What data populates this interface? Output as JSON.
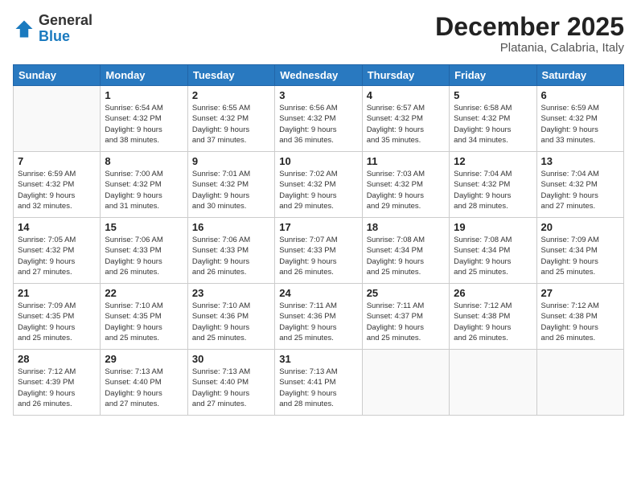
{
  "logo": {
    "general": "General",
    "blue": "Blue"
  },
  "header": {
    "month": "December 2025",
    "location": "Platania, Calabria, Italy"
  },
  "weekdays": [
    "Sunday",
    "Monday",
    "Tuesday",
    "Wednesday",
    "Thursday",
    "Friday",
    "Saturday"
  ],
  "weeks": [
    [
      {
        "day": "",
        "info": ""
      },
      {
        "day": "1",
        "info": "Sunrise: 6:54 AM\nSunset: 4:32 PM\nDaylight: 9 hours\nand 38 minutes."
      },
      {
        "day": "2",
        "info": "Sunrise: 6:55 AM\nSunset: 4:32 PM\nDaylight: 9 hours\nand 37 minutes."
      },
      {
        "day": "3",
        "info": "Sunrise: 6:56 AM\nSunset: 4:32 PM\nDaylight: 9 hours\nand 36 minutes."
      },
      {
        "day": "4",
        "info": "Sunrise: 6:57 AM\nSunset: 4:32 PM\nDaylight: 9 hours\nand 35 minutes."
      },
      {
        "day": "5",
        "info": "Sunrise: 6:58 AM\nSunset: 4:32 PM\nDaylight: 9 hours\nand 34 minutes."
      },
      {
        "day": "6",
        "info": "Sunrise: 6:59 AM\nSunset: 4:32 PM\nDaylight: 9 hours\nand 33 minutes."
      }
    ],
    [
      {
        "day": "7",
        "info": "Sunrise: 6:59 AM\nSunset: 4:32 PM\nDaylight: 9 hours\nand 32 minutes."
      },
      {
        "day": "8",
        "info": "Sunrise: 7:00 AM\nSunset: 4:32 PM\nDaylight: 9 hours\nand 31 minutes."
      },
      {
        "day": "9",
        "info": "Sunrise: 7:01 AM\nSunset: 4:32 PM\nDaylight: 9 hours\nand 30 minutes."
      },
      {
        "day": "10",
        "info": "Sunrise: 7:02 AM\nSunset: 4:32 PM\nDaylight: 9 hours\nand 29 minutes."
      },
      {
        "day": "11",
        "info": "Sunrise: 7:03 AM\nSunset: 4:32 PM\nDaylight: 9 hours\nand 29 minutes."
      },
      {
        "day": "12",
        "info": "Sunrise: 7:04 AM\nSunset: 4:32 PM\nDaylight: 9 hours\nand 28 minutes."
      },
      {
        "day": "13",
        "info": "Sunrise: 7:04 AM\nSunset: 4:32 PM\nDaylight: 9 hours\nand 27 minutes."
      }
    ],
    [
      {
        "day": "14",
        "info": "Sunrise: 7:05 AM\nSunset: 4:32 PM\nDaylight: 9 hours\nand 27 minutes."
      },
      {
        "day": "15",
        "info": "Sunrise: 7:06 AM\nSunset: 4:33 PM\nDaylight: 9 hours\nand 26 minutes."
      },
      {
        "day": "16",
        "info": "Sunrise: 7:06 AM\nSunset: 4:33 PM\nDaylight: 9 hours\nand 26 minutes."
      },
      {
        "day": "17",
        "info": "Sunrise: 7:07 AM\nSunset: 4:33 PM\nDaylight: 9 hours\nand 26 minutes."
      },
      {
        "day": "18",
        "info": "Sunrise: 7:08 AM\nSunset: 4:34 PM\nDaylight: 9 hours\nand 25 minutes."
      },
      {
        "day": "19",
        "info": "Sunrise: 7:08 AM\nSunset: 4:34 PM\nDaylight: 9 hours\nand 25 minutes."
      },
      {
        "day": "20",
        "info": "Sunrise: 7:09 AM\nSunset: 4:34 PM\nDaylight: 9 hours\nand 25 minutes."
      }
    ],
    [
      {
        "day": "21",
        "info": "Sunrise: 7:09 AM\nSunset: 4:35 PM\nDaylight: 9 hours\nand 25 minutes."
      },
      {
        "day": "22",
        "info": "Sunrise: 7:10 AM\nSunset: 4:35 PM\nDaylight: 9 hours\nand 25 minutes."
      },
      {
        "day": "23",
        "info": "Sunrise: 7:10 AM\nSunset: 4:36 PM\nDaylight: 9 hours\nand 25 minutes."
      },
      {
        "day": "24",
        "info": "Sunrise: 7:11 AM\nSunset: 4:36 PM\nDaylight: 9 hours\nand 25 minutes."
      },
      {
        "day": "25",
        "info": "Sunrise: 7:11 AM\nSunset: 4:37 PM\nDaylight: 9 hours\nand 25 minutes."
      },
      {
        "day": "26",
        "info": "Sunrise: 7:12 AM\nSunset: 4:38 PM\nDaylight: 9 hours\nand 26 minutes."
      },
      {
        "day": "27",
        "info": "Sunrise: 7:12 AM\nSunset: 4:38 PM\nDaylight: 9 hours\nand 26 minutes."
      }
    ],
    [
      {
        "day": "28",
        "info": "Sunrise: 7:12 AM\nSunset: 4:39 PM\nDaylight: 9 hours\nand 26 minutes."
      },
      {
        "day": "29",
        "info": "Sunrise: 7:13 AM\nSunset: 4:40 PM\nDaylight: 9 hours\nand 27 minutes."
      },
      {
        "day": "30",
        "info": "Sunrise: 7:13 AM\nSunset: 4:40 PM\nDaylight: 9 hours\nand 27 minutes."
      },
      {
        "day": "31",
        "info": "Sunrise: 7:13 AM\nSunset: 4:41 PM\nDaylight: 9 hours\nand 28 minutes."
      },
      {
        "day": "",
        "info": ""
      },
      {
        "day": "",
        "info": ""
      },
      {
        "day": "",
        "info": ""
      }
    ]
  ]
}
